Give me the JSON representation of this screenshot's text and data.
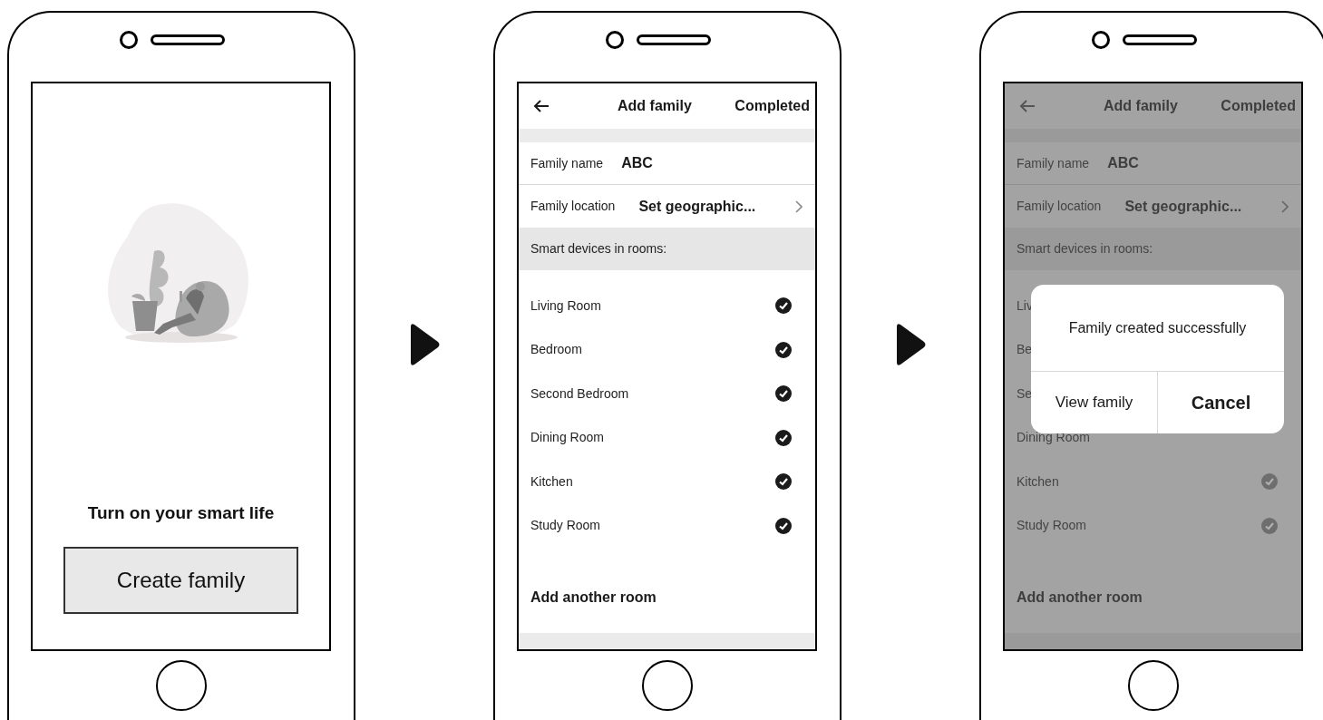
{
  "screens": [
    {
      "kind": "welcome",
      "tagline": "Turn on your smart life",
      "button": "Create family"
    },
    {
      "kind": "form",
      "dimmed": false,
      "title": "Add family",
      "action": "Completed",
      "fields": [
        {
          "label": "Family name",
          "value": "ABC",
          "kind": "text"
        },
        {
          "label": "Family location",
          "value": "Set geographic...",
          "kind": "link"
        }
      ],
      "section": "Smart devices in rooms:",
      "rooms": [
        {
          "name": "Living Room",
          "checked": true
        },
        {
          "name": "Bedroom",
          "checked": true
        },
        {
          "name": "Second Bedroom",
          "checked": true
        },
        {
          "name": "Dining Room",
          "checked": true
        },
        {
          "name": "Kitchen",
          "checked": true
        },
        {
          "name": "Study Room",
          "checked": true
        }
      ],
      "add_room": "Add another room"
    },
    {
      "kind": "form",
      "dimmed": true,
      "title": "Add family",
      "action": "Completed",
      "fields": [
        {
          "label": "Family name",
          "value": "ABC",
          "kind": "text"
        },
        {
          "label": "Family location",
          "value": "Set geographic...",
          "kind": "link"
        }
      ],
      "section": "Smart devices in rooms:",
      "rooms": [
        {
          "name": "Liv"
        },
        {
          "name": "Be"
        },
        {
          "name": "Se"
        },
        {
          "name": "Dining Room"
        },
        {
          "name": "Kitchen",
          "checked": true
        },
        {
          "name": "Study Room",
          "checked": true
        }
      ],
      "add_room": "Add another room",
      "dialog": {
        "message": "Family created successfully",
        "buttons": [
          {
            "label": "View family",
            "kind": "plain"
          },
          {
            "label": "Cancel",
            "kind": "primary"
          }
        ]
      }
    }
  ]
}
